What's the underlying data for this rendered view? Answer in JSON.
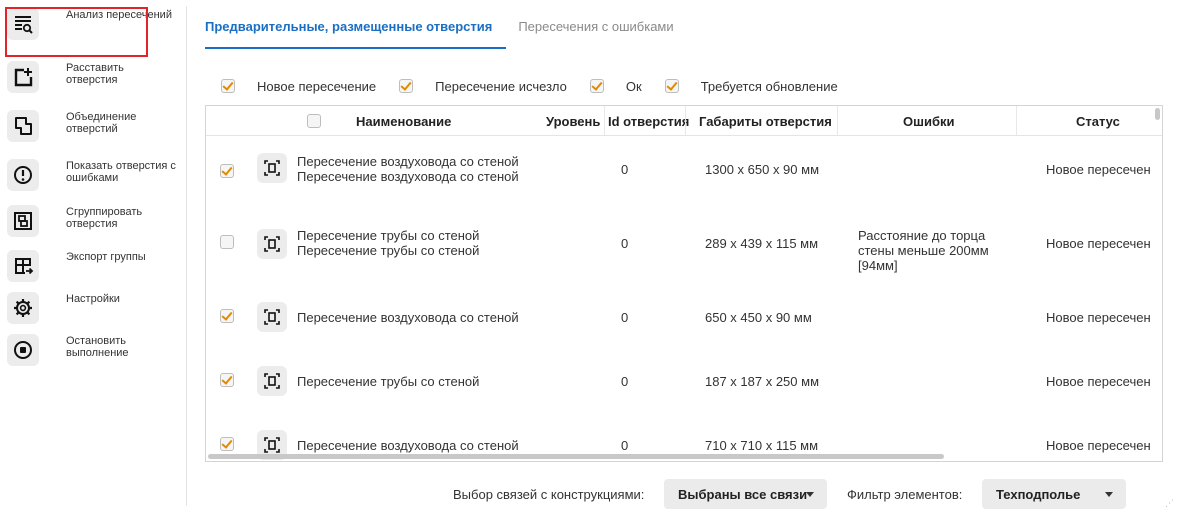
{
  "sidebar": {
    "items": [
      {
        "label": "Анализ пересечений",
        "icon": "filter-search-icon",
        "active": true
      },
      {
        "label": "Расставить отверстия",
        "icon": "add-opening-icon"
      },
      {
        "label": "Объединение отверстий",
        "icon": "merge-icon"
      },
      {
        "label": "Показать отверстия с ошибками",
        "icon": "error-icon"
      },
      {
        "label": "Сгруппировать отверстия",
        "icon": "group-icon"
      },
      {
        "label": "Экспорт группы",
        "icon": "export-icon"
      },
      {
        "label": "Настройки",
        "icon": "gear-icon"
      },
      {
        "label": "Остановить выполнение",
        "icon": "stop-icon"
      }
    ]
  },
  "tabs": [
    {
      "label": "Предварительные, размещенные отверстия",
      "active": true
    },
    {
      "label": "Пересечения с ошибками",
      "active": false
    }
  ],
  "filters": [
    {
      "label": "Новое пересечение",
      "checked": true
    },
    {
      "label": "Пересечение исчезло",
      "checked": true
    },
    {
      "label": "Ок",
      "checked": true
    },
    {
      "label": "Требуется обновление",
      "checked": true
    }
  ],
  "table": {
    "columns": [
      "Наименование",
      "Уровень",
      "Id отверстия",
      "Габариты отверстия",
      "Ошибки",
      "Статус"
    ],
    "rows": [
      {
        "checked": true,
        "name_1": "Пересечение воздуховода со стеной",
        "name_2": "Пересечение воздуховода со стеной",
        "level": "0",
        "size": "1300 х 650 х 90 мм",
        "error_1": "",
        "error_2": "",
        "error_3": "",
        "status": "Новое пересечен"
      },
      {
        "checked": false,
        "name_1": "Пересечение трубы со стеной",
        "name_2": "Пересечение трубы со стеной",
        "level": "0",
        "size": "289 х 439 х 115 мм",
        "error_1": "Расстояние до торца",
        "error_2": "стены меньше 200мм",
        "error_3": "[94мм]",
        "status": "Новое пересечен"
      },
      {
        "checked": true,
        "name_1": "Пересечение воздуховода со стеной",
        "name_2": "",
        "level": "0",
        "size": "650 х 450 х 90 мм",
        "error_1": "",
        "error_2": "",
        "error_3": "",
        "status": "Новое пересечен"
      },
      {
        "checked": true,
        "name_1": "Пересечение трубы со стеной",
        "name_2": "",
        "level": "0",
        "size": "187 х 187 х 250 мм",
        "error_1": "",
        "error_2": "",
        "error_3": "",
        "status": "Новое пересечен"
      },
      {
        "checked": true,
        "name_1": "Пересечение воздуховода со стеной",
        "name_2": "",
        "level": "0",
        "size": "710 х 710 х 115 мм",
        "error_1": "",
        "error_2": "",
        "error_3": "",
        "status": "Новое пересечен"
      }
    ]
  },
  "bottom": {
    "links_label": "Выбор связей с конструкциями:",
    "links_value": "Выбраны все связи",
    "filter_label": "Фильтр элементов:",
    "filter_value": "Техподполье"
  },
  "colors": {
    "accent": "#1a6fc4",
    "check": "#e08a00",
    "active_outline": "#e0242b"
  }
}
